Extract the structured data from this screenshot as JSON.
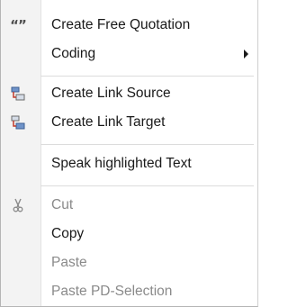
{
  "menu": {
    "items": [
      {
        "label": "Create Free Quotation",
        "icon": "quote-icon",
        "enabled": true
      },
      {
        "label": "Coding",
        "icon": "",
        "enabled": true,
        "submenu": true
      },
      {
        "label": "Create Link Source",
        "icon": "link-source-icon",
        "enabled": true
      },
      {
        "label": "Create Link Target",
        "icon": "link-target-icon",
        "enabled": true
      },
      {
        "label": "Speak highlighted Text",
        "icon": "",
        "enabled": true
      },
      {
        "label": "Cut",
        "icon": "scissors-icon",
        "enabled": false
      },
      {
        "label": "Copy",
        "icon": "",
        "enabled": true
      },
      {
        "label": "Paste",
        "icon": "",
        "enabled": false
      },
      {
        "label": "Paste PD-Selection",
        "icon": "",
        "enabled": false
      }
    ],
    "quote_glyph": "“”"
  },
  "colors": {
    "text": "#1a1a1a",
    "disabled_text": "#8a8a8a",
    "gutter": "#f3f3f3",
    "separator": "#dcdcdc",
    "icon_red": "#c0392b",
    "icon_blue": "#6f93c9"
  }
}
